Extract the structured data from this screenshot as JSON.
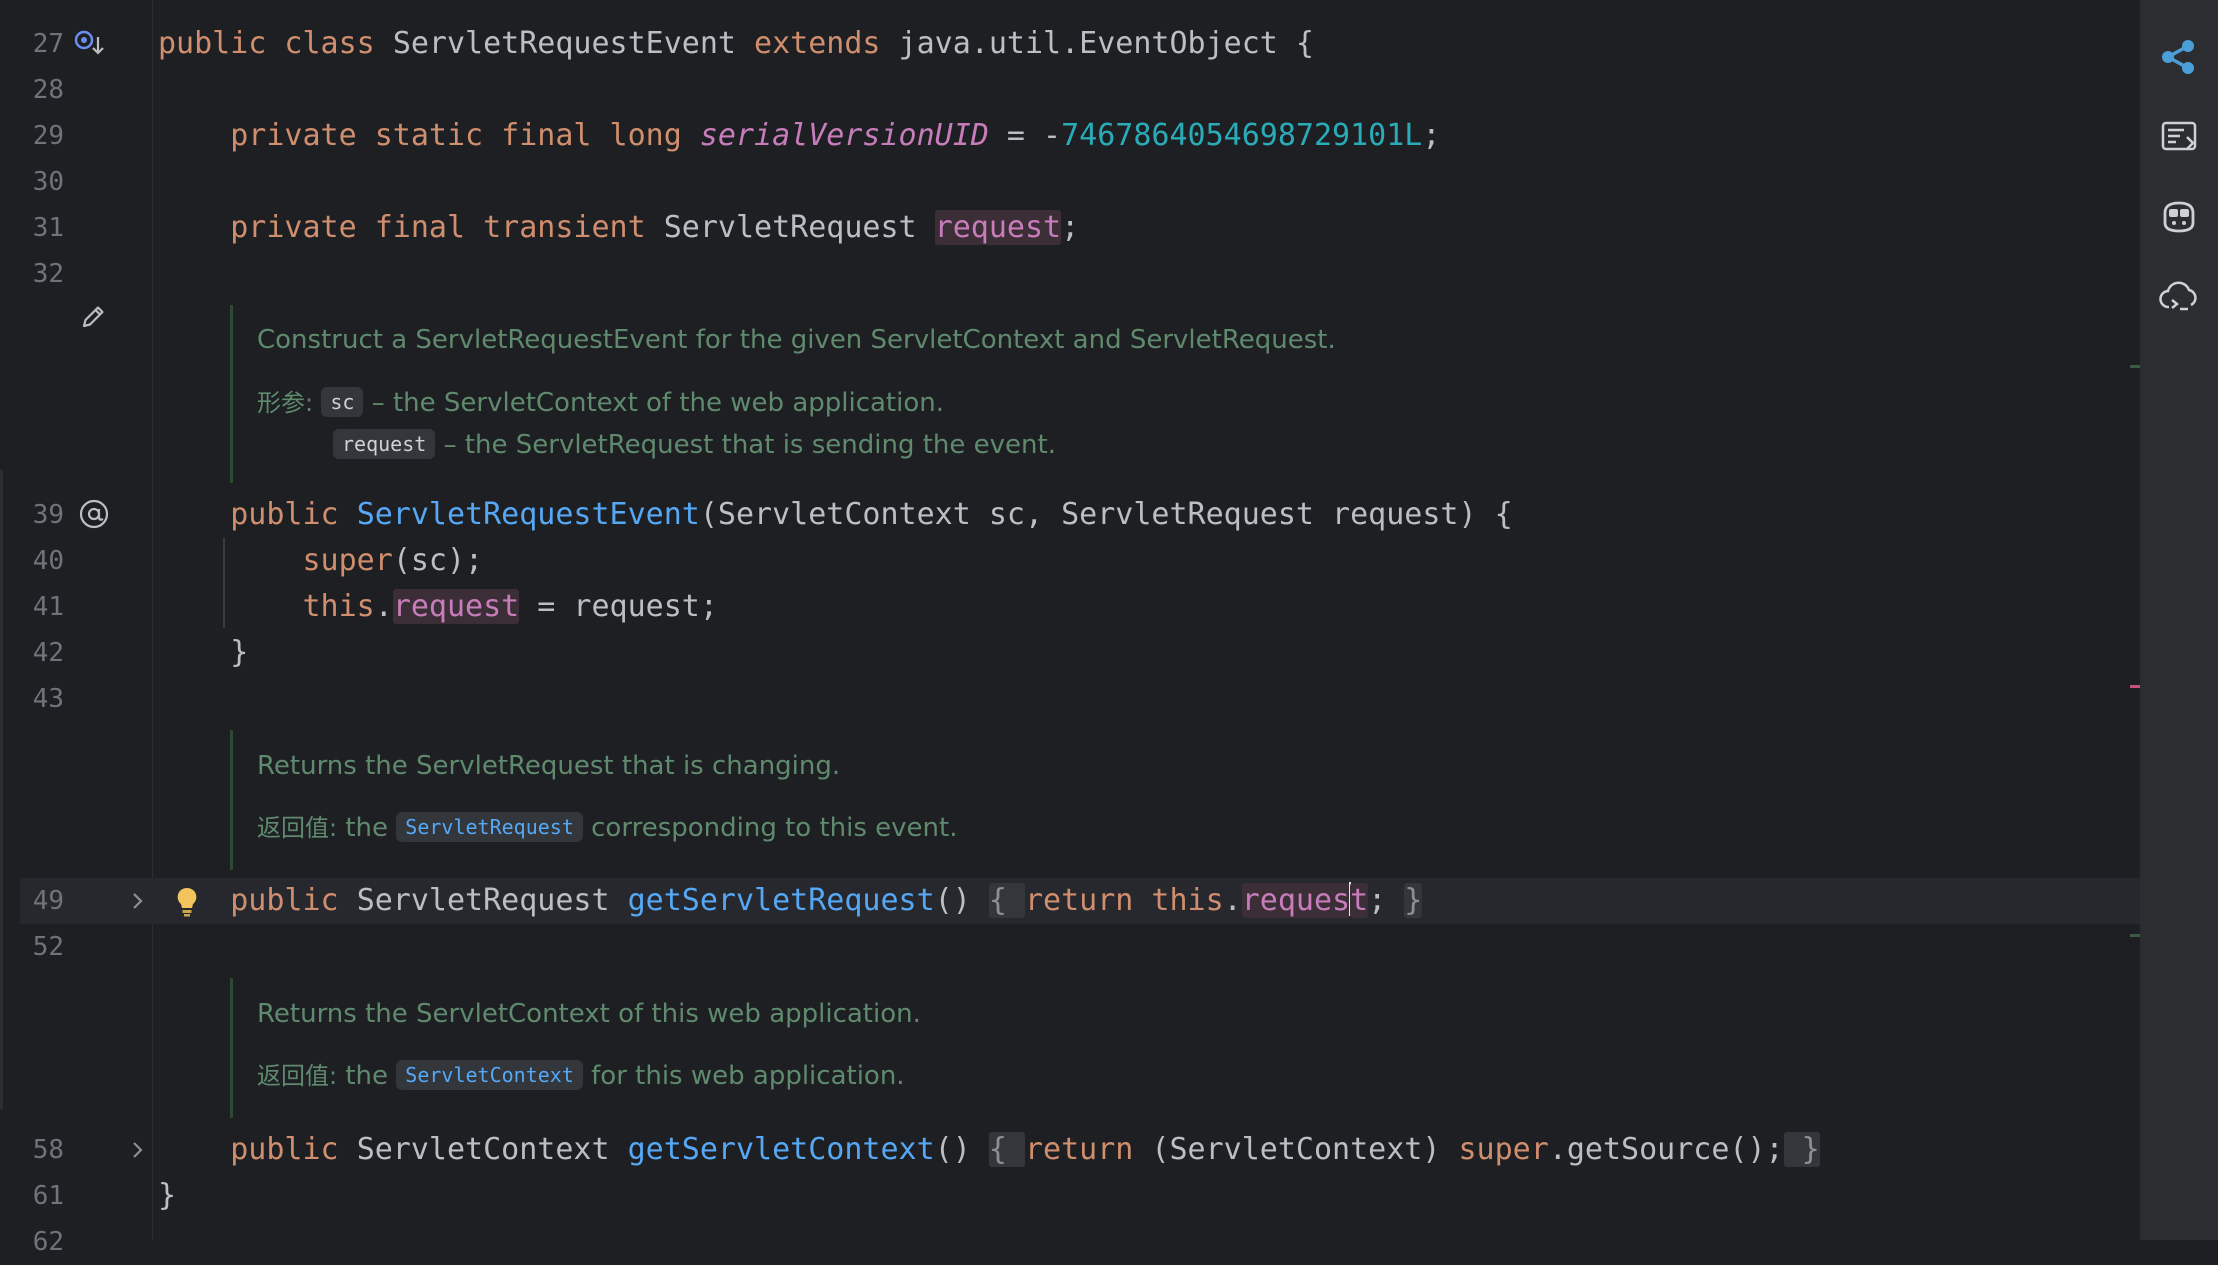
{
  "editor": {
    "lines": [
      {
        "num": "27",
        "parts": [
          {
            "t": "public class ",
            "c": "kw"
          },
          {
            "t": "ServletRequestEvent "
          },
          {
            "t": "extends ",
            "c": "kw"
          },
          {
            "t": "java.util.EventObject {"
          }
        ]
      },
      {
        "num": "28",
        "parts": []
      },
      {
        "num": "29",
        "parts": [
          {
            "t": "    "
          },
          {
            "t": "private static final long ",
            "c": "kw"
          },
          {
            "t": "serialVersionUID",
            "c": "fld it"
          },
          {
            "t": " = -"
          },
          {
            "t": "7467864054698729101L",
            "c": "num"
          },
          {
            "t": ";"
          }
        ]
      },
      {
        "num": "30",
        "parts": []
      },
      {
        "num": "31",
        "parts": [
          {
            "t": "    "
          },
          {
            "t": "private final transient ",
            "c": "kw"
          },
          {
            "t": "ServletRequest "
          },
          {
            "t": "request",
            "c": "fld hl"
          },
          {
            "t": ";"
          }
        ]
      },
      {
        "num": "32",
        "parts": []
      },
      {
        "num": "39",
        "parts": [
          {
            "t": "    "
          },
          {
            "t": "public ",
            "c": "kw"
          },
          {
            "t": "ServletRequestEvent",
            "c": "fn"
          },
          {
            "t": "(ServletContext sc, ServletRequest request) {"
          }
        ]
      },
      {
        "num": "40",
        "parts": [
          {
            "t": "        "
          },
          {
            "t": "super",
            "c": "kw"
          },
          {
            "t": "(sc);"
          }
        ]
      },
      {
        "num": "41",
        "parts": [
          {
            "t": "        "
          },
          {
            "t": "this",
            "c": "kw"
          },
          {
            "t": "."
          },
          {
            "t": "request",
            "c": "fld hl"
          },
          {
            "t": " = request;"
          }
        ]
      },
      {
        "num": "42",
        "parts": [
          {
            "t": "    }"
          }
        ]
      },
      {
        "num": "43",
        "parts": []
      },
      {
        "num": "49",
        "parts": [
          {
            "t": "    "
          },
          {
            "t": "public ",
            "c": "kw"
          },
          {
            "t": "ServletRequest "
          },
          {
            "t": "getServletRequest",
            "c": "fn"
          },
          {
            "t": "() "
          },
          {
            "t": "{ ",
            "c": "fold"
          },
          {
            "t": "return this",
            "c": "kw"
          },
          {
            "t": "."
          },
          {
            "t": "reques",
            "c": "fld hl"
          },
          {
            "caret": true
          },
          {
            "t": "t",
            "c": "fld hl"
          },
          {
            "t": "; "
          },
          {
            "t": "}",
            "c": "fold"
          }
        ]
      },
      {
        "num": "52",
        "parts": []
      },
      {
        "num": "58",
        "parts": [
          {
            "t": "    "
          },
          {
            "t": "public ",
            "c": "kw"
          },
          {
            "t": "ServletContext "
          },
          {
            "t": "getServletContext",
            "c": "fn"
          },
          {
            "t": "() "
          },
          {
            "t": "{ ",
            "c": "fold"
          },
          {
            "t": "return ",
            "c": "kw"
          },
          {
            "t": "(ServletContext) "
          },
          {
            "t": "super",
            "c": "kw"
          },
          {
            "t": ".getSource();"
          },
          {
            "t": " }",
            "c": "fold"
          }
        ]
      },
      {
        "num": "61",
        "parts": [
          {
            "t": "}"
          }
        ]
      },
      {
        "num": "62",
        "parts": []
      }
    ],
    "doc1": {
      "summary": "Construct a ServletRequestEvent for the given ServletContext and ServletRequest.",
      "param_label": "形参:",
      "p1_name": "sc",
      "p1_desc": "– the ServletContext of the web application.",
      "p2_name": "request",
      "p2_desc": "– the ServletRequest that is sending the event."
    },
    "doc2": {
      "summary": "Returns the ServletRequest that is changing.",
      "return_label": "返回值:",
      "pre": "the",
      "link": "ServletRequest",
      "post": "corresponding to this event."
    },
    "doc3": {
      "summary": "Returns the ServletContext of this web application.",
      "return_label": "返回值:",
      "pre": "the",
      "link": "ServletContext",
      "post": "for this web application."
    }
  },
  "colors": {
    "background": "#1e1f22",
    "keyword": "#cf8e6d",
    "field": "#c77dbb",
    "number": "#2aacb8",
    "method": "#56a8f5",
    "doc": "#5f8a6e"
  },
  "icons": {
    "line27": "implemented-override-icon",
    "doc_edit": "pencil-icon",
    "line39": "annotation-at-icon",
    "line49": "lightbulb-icon",
    "fold49": "chevron-right-icon",
    "fold58": "chevron-right-icon"
  },
  "toolbar": [
    "share-icon",
    "run-console-icon",
    "copilot-icon",
    "cloud-code-icon"
  ]
}
